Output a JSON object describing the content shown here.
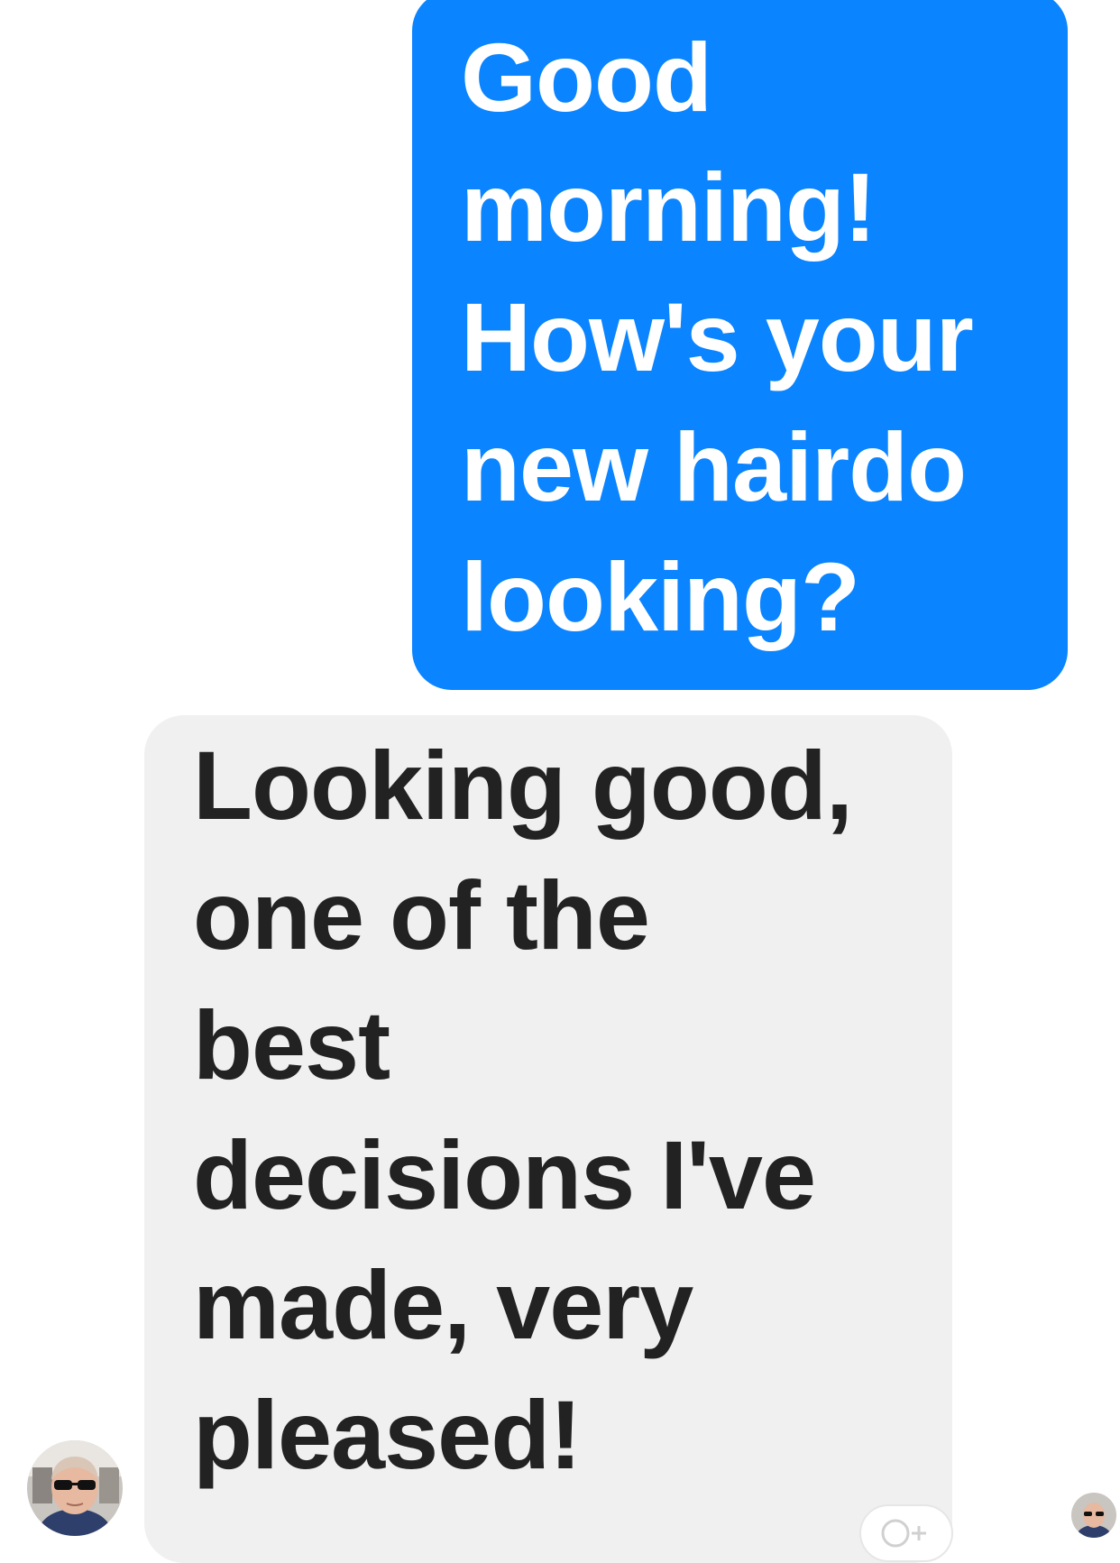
{
  "conversation": {
    "messages": [
      {
        "direction": "outgoing",
        "text": "Good\nmorning!\nHow's your\nnew hairdo\nlooking?"
      },
      {
        "direction": "incoming",
        "text": "Looking good,\none of the\nbest\ndecisions I've\nmade, very\npleased!"
      }
    ]
  },
  "colors": {
    "outgoing_bubble": "#0a84ff",
    "incoming_bubble": "#f0f0f0",
    "incoming_text": "#222222",
    "background": "#ffffff"
  },
  "icons": {
    "sender_avatar": "contact-avatar-photo",
    "read_receipt": "read-receipt-avatar",
    "reaction": "add-reaction-icon"
  }
}
